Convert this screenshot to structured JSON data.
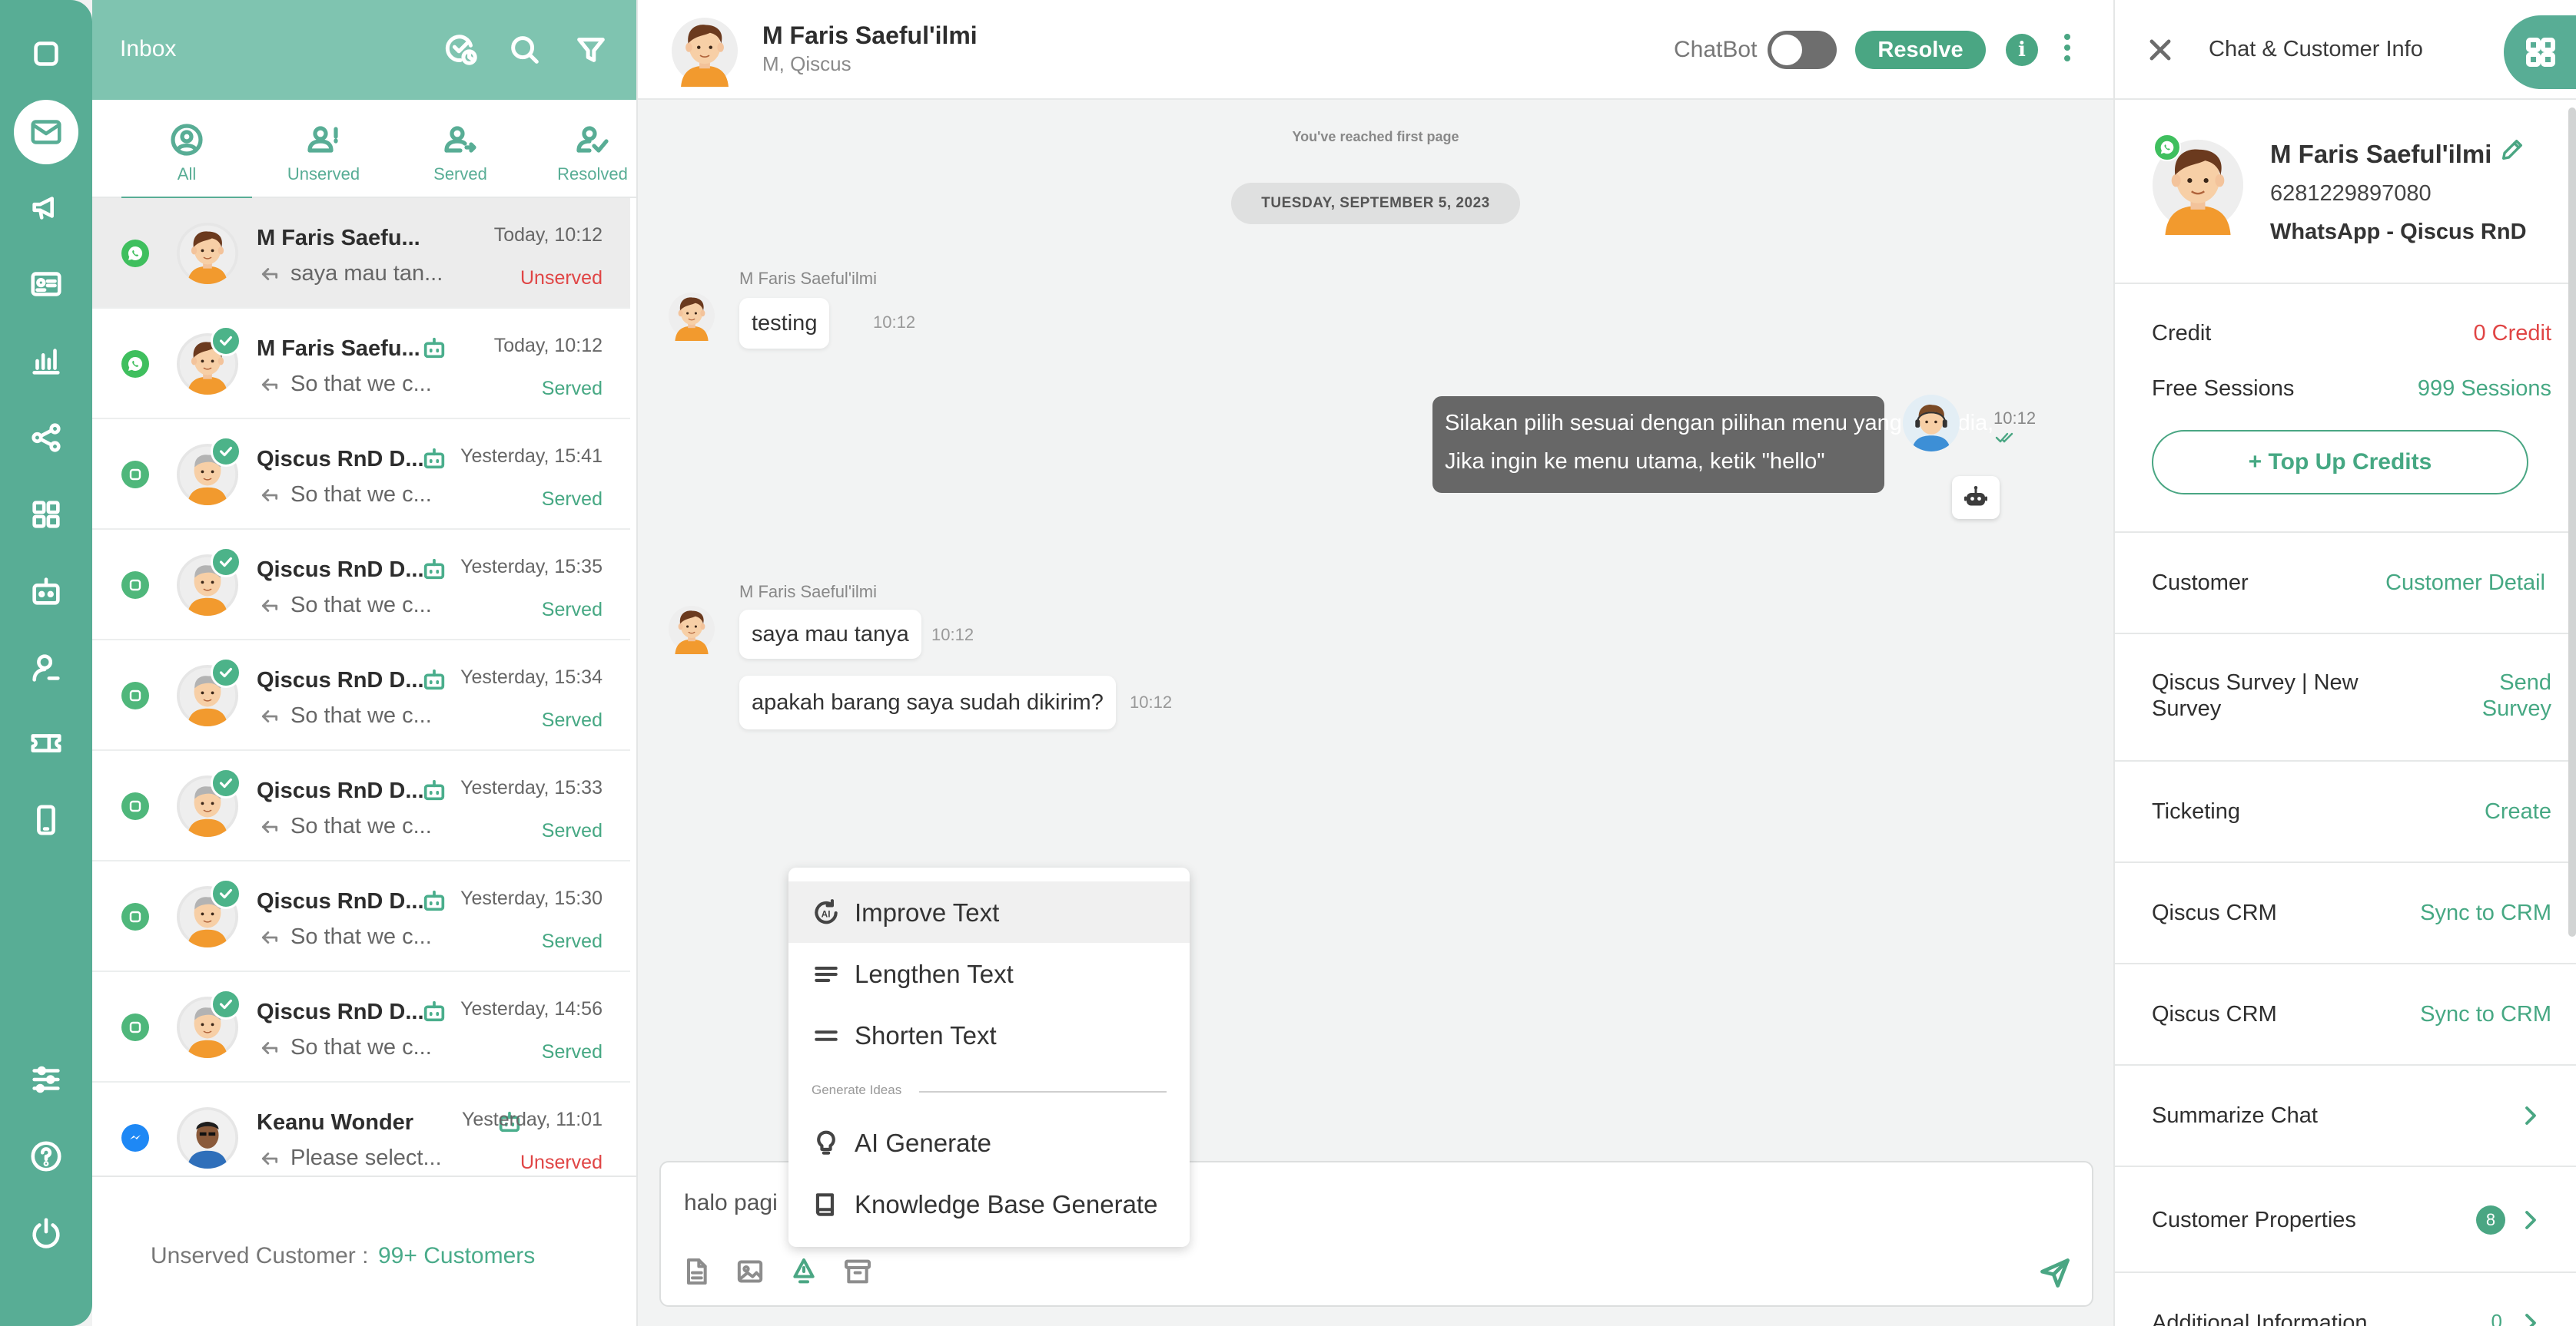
{
  "inbox": {
    "title": "Inbox",
    "tabs": [
      {
        "label": "All"
      },
      {
        "label": "Unserved"
      },
      {
        "label": "Served"
      },
      {
        "label": "Resolved"
      }
    ],
    "conversations": [
      {
        "name": "M Faris Saefu...",
        "time": "Today, 10:12",
        "preview": "saya mau tan...",
        "status": "Unserved",
        "channel": "whatsapp",
        "bot": false,
        "resolved": false
      },
      {
        "name": "M Faris Saefu...",
        "time": "Today, 10:12",
        "preview": "So that we c...",
        "status": "Served",
        "channel": "whatsapp",
        "bot": true,
        "resolved": true
      },
      {
        "name": "Qiscus RnD D...",
        "time": "Yesterday, 15:41",
        "preview": "So that we c...",
        "status": "Served",
        "channel": "qiscus",
        "bot": true,
        "resolved": true
      },
      {
        "name": "Qiscus RnD D...",
        "time": "Yesterday, 15:35",
        "preview": "So that we c...",
        "status": "Served",
        "channel": "qiscus",
        "bot": true,
        "resolved": true
      },
      {
        "name": "Qiscus RnD D...",
        "time": "Yesterday, 15:34",
        "preview": "So that we c...",
        "status": "Served",
        "channel": "qiscus",
        "bot": true,
        "resolved": true
      },
      {
        "name": "Qiscus RnD D...",
        "time": "Yesterday, 15:33",
        "preview": "So that we c...",
        "status": "Served",
        "channel": "qiscus",
        "bot": true,
        "resolved": true
      },
      {
        "name": "Qiscus RnD D...",
        "time": "Yesterday, 15:30",
        "preview": "So that we c...",
        "status": "Served",
        "channel": "qiscus",
        "bot": true,
        "resolved": true
      },
      {
        "name": "Qiscus RnD D...",
        "time": "Yesterday, 14:56",
        "preview": "So that we c...",
        "status": "Served",
        "channel": "qiscus",
        "bot": true,
        "resolved": true
      },
      {
        "name": "Keanu Wonder",
        "time": "Yesterday, 11:01",
        "preview": "Please select...",
        "status": "Unserved",
        "channel": "messenger",
        "bot": true,
        "resolved": false
      }
    ],
    "footer": {
      "label": "Unserved Customer :",
      "value": "99+ Customers"
    }
  },
  "chat": {
    "name": "M Faris Saeful'ilmi",
    "subtitle": "M, Qiscus",
    "chatbot_label": "ChatBot",
    "resolve_label": "Resolve",
    "info_glyph": "i",
    "first_page": "You've reached first page",
    "date": "TUESDAY, SEPTEMBER 5, 2023",
    "messages": {
      "m1_sender": "M Faris Saeful'ilmi",
      "m1_text": "testing",
      "m1_time": "10:12",
      "out_time": "10:12",
      "out_line1": "Silakan pilih sesuai dengan pilihan menu yang tersedia,",
      "out_line2": "Jika ingin ke menu utama, ketik \"hello\"",
      "m2_sender": "M Faris Saeful'ilmi",
      "m2_text": "saya mau tanya",
      "m2_time": "10:12",
      "m3_text": "apakah barang saya sudah dikirim?",
      "m3_time": "10:12"
    },
    "ai_menu": {
      "improve": "Improve Text",
      "lengthen": "Lengthen Text",
      "shorten": "Shorten Text",
      "section": "Generate Ideas",
      "generate": "AI Generate",
      "kb_generate": "Knowledge Base Generate"
    },
    "composer_text": "halo pagi"
  },
  "info": {
    "title": "Chat & Customer Info",
    "name": "M Faris Saeful'ilmi",
    "phone": "6281229897080",
    "channel": "WhatsApp - Qiscus RnD",
    "credit_label": "Credit",
    "credit_value": "0 Credit",
    "sessions_label": "Free Sessions",
    "sessions_value": "999 Sessions",
    "topup_label": "Top Up Credits",
    "customer_label": "Customer",
    "customer_link": "Customer Detail",
    "survey_label_1": "Qiscus Survey | New",
    "survey_label_2": "Survey",
    "survey_link_1": "Send",
    "survey_link_2": "Survey",
    "ticketing_label": "Ticketing",
    "ticketing_link": "Create",
    "crm1_label": "Qiscus CRM",
    "crm1_link": "Sync to CRM",
    "crm2_label": "Qiscus CRM",
    "crm2_link": "Sync to CRM",
    "summarize_label": "Summarize Chat",
    "properties_label": "Customer Properties",
    "properties_count": "8",
    "additional_label": "Additional Information",
    "additional_count": "0"
  },
  "colors": {
    "accent": "#58ad95",
    "served": "#46a883",
    "unserved": "#e04545",
    "header": "#7fc4b0"
  }
}
